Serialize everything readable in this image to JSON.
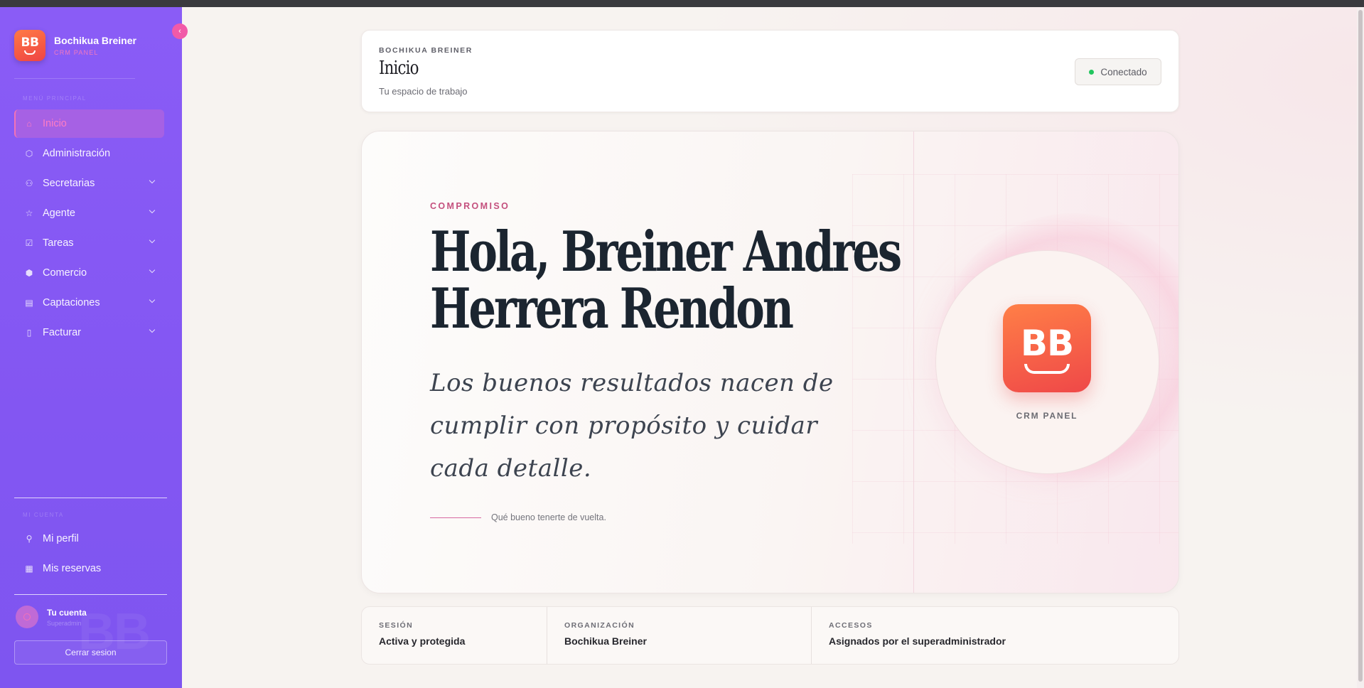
{
  "sidebar": {
    "brand_name": "Bochikua Breiner",
    "brand_sub": "CRM PANEL",
    "logo_letters": "BB",
    "collapse_icon": "chevron-left-icon",
    "section_main": "MENÚ PRINCIPAL",
    "nav": [
      {
        "label": "Inicio",
        "icon": "home-icon",
        "active": true,
        "expandable": false
      },
      {
        "label": "Administración",
        "icon": "cube-icon",
        "active": false,
        "expandable": false
      },
      {
        "label": "Secretarias",
        "icon": "users-icon",
        "active": false,
        "expandable": true
      },
      {
        "label": "Agente",
        "icon": "star-icon",
        "active": false,
        "expandable": true
      },
      {
        "label": "Tareas",
        "icon": "clipboard-check-icon",
        "active": false,
        "expandable": true
      },
      {
        "label": "Comercio",
        "icon": "box-icon",
        "active": false,
        "expandable": true
      },
      {
        "label": "Captaciones",
        "icon": "clipboard-icon",
        "active": false,
        "expandable": true
      },
      {
        "label": "Facturar",
        "icon": "file-icon",
        "active": false,
        "expandable": true
      }
    ],
    "section_account": "MI CUENTA",
    "account_nav": [
      {
        "label": "Mi perfil",
        "icon": "user-icon"
      },
      {
        "label": "Mis reservas",
        "icon": "calendar-icon"
      }
    ],
    "account_name": "Tu cuenta",
    "account_sub": "Superadmin",
    "logout_label": "Cerrar sesion",
    "accent_color": "#8a5cf6",
    "active_color": "#f472b6"
  },
  "header": {
    "eyebrow": "BOCHIKUA BREINER",
    "title": "Inicio",
    "subtitle": "Tu espacio de trabajo",
    "status_label": "Conectado",
    "status_color": "#22c55e"
  },
  "hero": {
    "eyebrow": "COMPROMISO",
    "title_line1": "Hola, Breiner Andres",
    "title_line2": "Herrera Rendon",
    "quote_line1": "Los buenos resultados nacen de",
    "quote_line2": "cumplir con propósito y cuidar",
    "quote_line3": "cada detalle.",
    "signature": "Qué bueno tenerte de vuelta.",
    "logo_letters": "BB",
    "logo_caption": "CRM PANEL"
  },
  "stats": [
    {
      "label": "SESIÓN",
      "value": "Activa y protegida"
    },
    {
      "label": "ORGANIZACIÓN",
      "value": "Bochikua Breiner"
    },
    {
      "label": "ACCESOS",
      "value": "Asignados por el superadministrador"
    }
  ]
}
